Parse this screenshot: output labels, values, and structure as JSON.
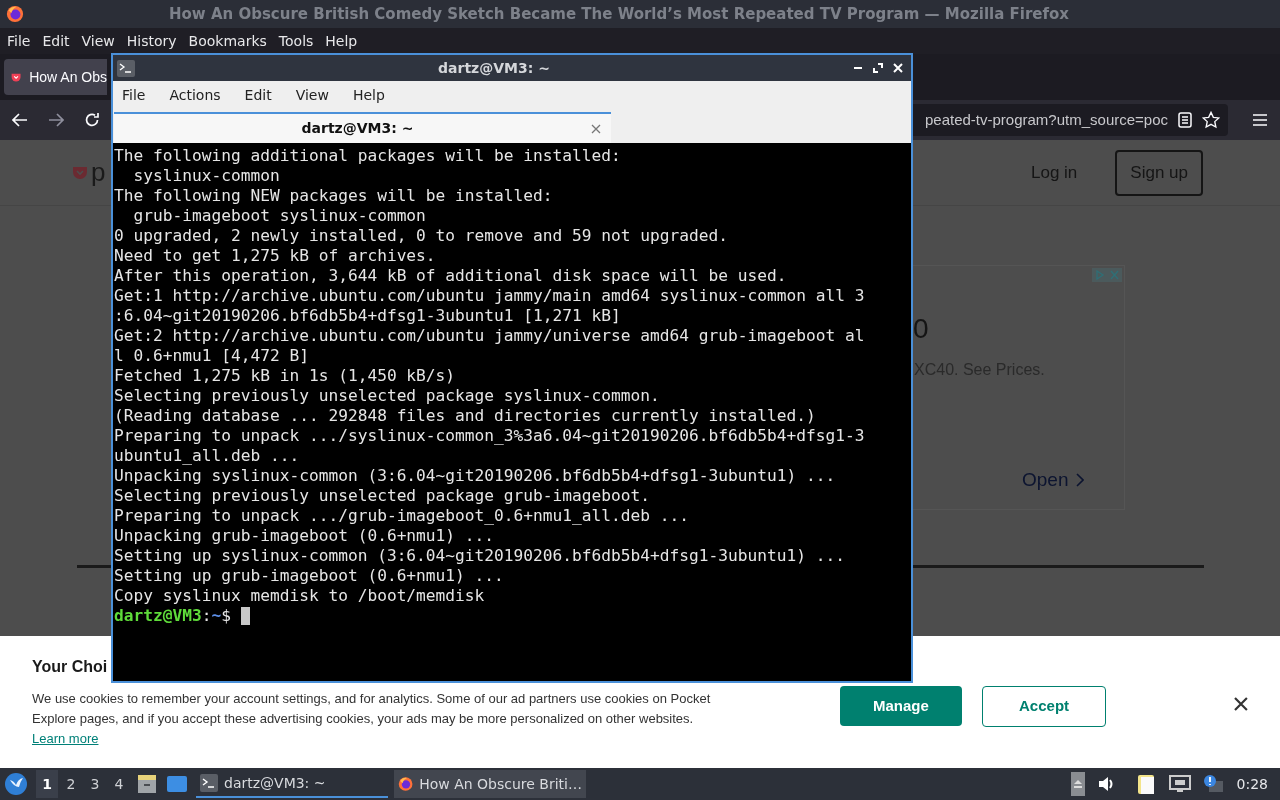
{
  "browser": {
    "title": "How An Obscure British Comedy Sketch Became The World’s Most Repeated TV Program — Mozilla Firefox",
    "menu": [
      "File",
      "Edit",
      "View",
      "History",
      "Bookmarks",
      "Tools",
      "Help"
    ],
    "tab": "How An Obs",
    "url": "peated-tv-program?utm_source=poc"
  },
  "page": {
    "logo_text": "p",
    "login": "Log in",
    "signup": "Sign up",
    "ad": {
      "headline": "0",
      "text": "XC40. See Prices.",
      "open": "Open"
    }
  },
  "cookie": {
    "title": "Your Choi",
    "text": "We use cookies to remember your account settings, and for analytics. Some of our ad partners use cookies on Pocket Explore pages, and if you accept these advertising cookies, your ads may be more personalized on other websites.",
    "link": "Learn more",
    "manage": "Manage",
    "accept": "Accept"
  },
  "terminal": {
    "title": "dartz@VM3: ~",
    "menu": [
      "File",
      "Actions",
      "Edit",
      "View",
      "Help"
    ],
    "tab": "dartz@VM3: ~",
    "lines": [
      "The following additional packages will be installed:",
      "  syslinux-common",
      "The following NEW packages will be installed:",
      "  grub-imageboot syslinux-common",
      "0 upgraded, 2 newly installed, 0 to remove and 59 not upgraded.",
      "Need to get 1,275 kB of archives.",
      "After this operation, 3,644 kB of additional disk space will be used.",
      "Get:1 http://archive.ubuntu.com/ubuntu jammy/main amd64 syslinux-common all 3",
      ":6.04~git20190206.bf6db5b4+dfsg1-3ubuntu1 [1,271 kB]",
      "Get:2 http://archive.ubuntu.com/ubuntu jammy/universe amd64 grub-imageboot al",
      "l 0.6+nmu1 [4,472 B]",
      "Fetched 1,275 kB in 1s (1,450 kB/s)",
      "Selecting previously unselected package syslinux-common.",
      "(Reading database ... 292848 files and directories currently installed.)",
      "Preparing to unpack .../syslinux-common_3%3a6.04~git20190206.bf6db5b4+dfsg1-3",
      "ubuntu1_all.deb ...",
      "Unpacking syslinux-common (3:6.04~git20190206.bf6db5b4+dfsg1-3ubuntu1) ...",
      "Selecting previously unselected package grub-imageboot.",
      "Preparing to unpack .../grub-imageboot_0.6+nmu1_all.deb ...",
      "Unpacking grub-imageboot (0.6+nmu1) ...",
      "Setting up syslinux-common (3:6.04~git20190206.bf6db5b4+dfsg1-3ubuntu1) ...",
      "Setting up grub-imageboot (0.6+nmu1) ...",
      "Copy syslinux memdisk to /boot/memdisk"
    ],
    "prompt": {
      "user": "dartz@VM3",
      "sep": ":",
      "path": "~",
      "sign": "$"
    }
  },
  "taskbar": {
    "workspaces": [
      {
        "label": "1",
        "selected": true
      },
      {
        "label": "2",
        "selected": false
      },
      {
        "label": "3",
        "selected": false
      },
      {
        "label": "4",
        "selected": false
      }
    ],
    "tasks": [
      {
        "label": "dartz@VM3: ~",
        "kind": "terminal",
        "selected": true
      },
      {
        "label": "How An Obscure Briti…",
        "kind": "browser",
        "selected": false
      }
    ],
    "clock": "0:28"
  }
}
